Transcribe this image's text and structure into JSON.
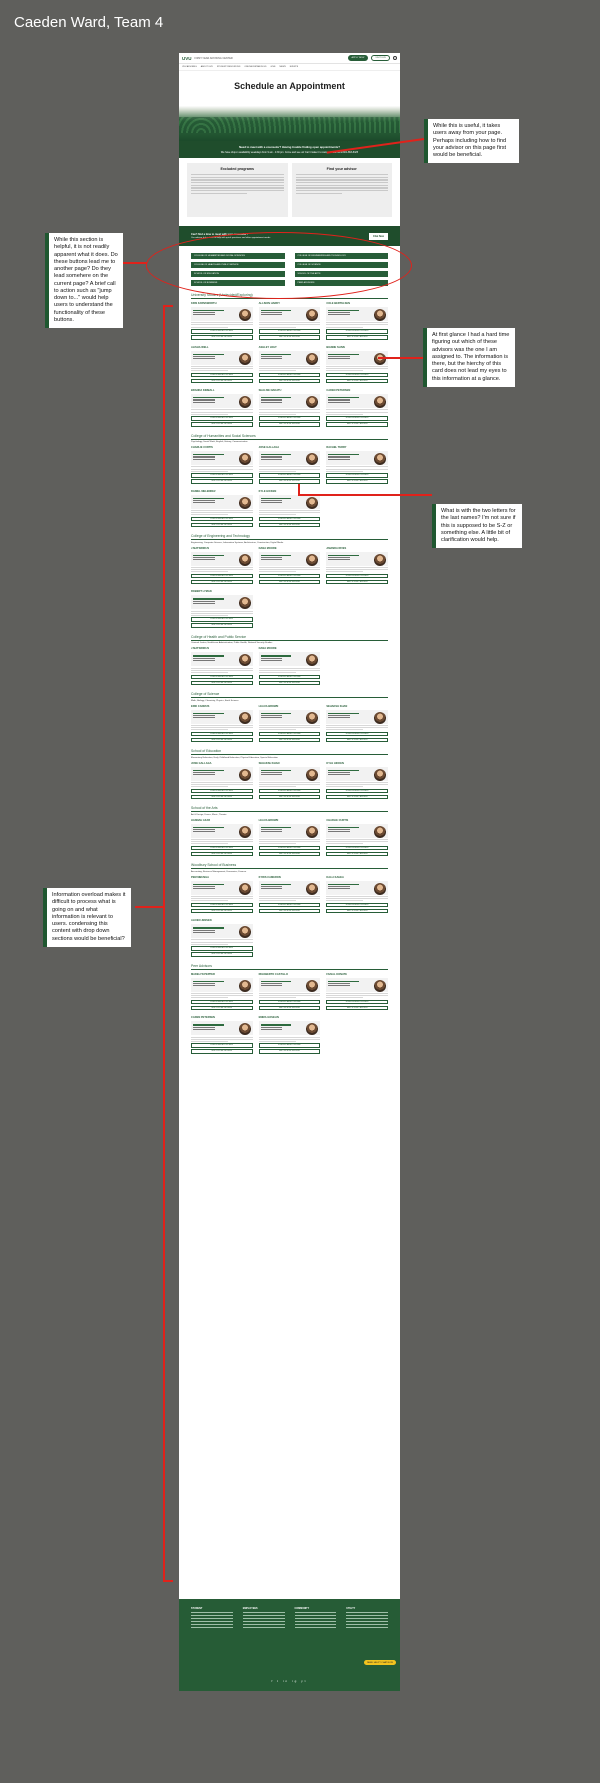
{
  "board": {
    "title": "Caeden Ward, Team 4"
  },
  "site": {
    "logo": "UVU",
    "top_text": "FIRST-YEAR ADVISING CENTER",
    "pill_primary": "APPLY NOW",
    "pill_secondary": "VISIT UVU",
    "nav": [
      "UVU ADVISING",
      "ABOUT UVU",
      "STUDENT RESOURCES",
      "ONLINE/DISTANCE ED",
      "GIVE",
      "NEWS",
      "EVENTS"
    ],
    "page_title": "Schedule an Appointment",
    "banner_line1": "Need to meet with a counselor? Having trouble finding open appointments?",
    "banner_line2": "We have drop-in availability weekdays from 9 am - 4:30 pm. Come and see us! Can't make it to campus? Call us at 801-863-8425",
    "excluded_title": "Excluded programs",
    "advisor_title": "Find your advisor",
    "cta_line1": "Can't find a time to meet with your counselor?",
    "cta_line2": "Our advisor hub is here to help with quick questions and other appointment needs.",
    "cta_button": "Chat Now",
    "jump_links": [
      "COLLEGE OF HUMANITIES AND SOCIAL SCIENCES",
      "COLLEGE OF ENGINEERING AND TECHNOLOGY",
      "COLLEGE OF HEALTH AND PUBLIC SERVICE",
      "COLLEGE OF SCIENCE",
      "SCHOOL OF EDUCATION",
      "SCHOOL OF THE ARTS",
      "SCHOOL OF BUSINESS",
      "PEER ADVISORS"
    ],
    "footer_cols": [
      "STUDENT",
      "EMPLOYEES",
      "COMMUNITY",
      "UTILITY"
    ],
    "help_pill": "NEED HELP? CHAT NOW",
    "social": "f t in ig yt"
  },
  "sections": [
    {
      "title": "University Studies (Undecided/Exploring)",
      "majors": "",
      "advisors": [
        "KRIS FARNSWORTH",
        "ALLISON HARDY",
        "COLE BERTELSEN",
        "ALISHA WELL",
        "ASHLEY HOLT",
        "BIANNE SLINN",
        "BRANDA KIMBALL",
        "SHALISE NAKATU",
        "CADEN PETERSEN"
      ]
    },
    {
      "title": "College of Humanities and Social Sciences",
      "majors": "Psychology, Social Work, English, History, Communication",
      "advisors": [
        "CHARLIE CURTIS",
        "JOSE GALLAGA",
        "RACHEL TERRY",
        "DANIEL MELENDEZ",
        "KYLE HICKEN"
      ]
    },
    {
      "title": "College of Engineering and Technology",
      "majors": "Engineering, Computer Science, Information Systems, Architecture, Construction, Digital Media",
      "advisors": [
        "J MATSIRIKUS",
        "DANA MOORE",
        "AMANDA RIVES",
        "ROBERT LYMAN"
      ]
    },
    {
      "title": "College of Health and Public Service",
      "majors": "Criminal Justice, Healthcare Administration, Public Health, National Security Studies",
      "advisors": [
        "J MATSIRIKUS",
        "DANA MOORE"
      ]
    },
    {
      "title": "College of Science",
      "majors": "Math, Biology, Chemistry, Physics, Earth Science",
      "advisors": [
        "ERIK CADMUS",
        "LEAUA BROWN",
        "SEHAKSH KHAN"
      ]
    },
    {
      "title": "School of Education",
      "majors": "Elementary Education, Early Childhood Education, Physical Education, Special Education",
      "advisors": [
        "JOSE GALLAGA",
        "SEHAKSH KHAN",
        "KYLE HICKEN"
      ]
    },
    {
      "title": "School of the Arts",
      "majors": "Art & Design, Dance, Music, Theater",
      "advisors": [
        "HANNAH AZAR",
        "LEAUA BROWN",
        "CHARLIE CURTIS"
      ]
    },
    {
      "title": "Woodbury School of Business",
      "majors": "Accounting, Business Management, Economics, Finance",
      "advisors": [
        "PEM MBUNGA",
        "KYRIS CAMERON",
        "KALLI KAHEA",
        "ALIXEN JENSEN"
      ]
    },
    {
      "title": "Peer Advisors",
      "majors": "",
      "advisors": [
        "MADELYN PEPPER",
        "RIGOBERTO CASTILLO",
        "FAISAL KONATE",
        "CADEN PETERSEN",
        "EMMA GOSELIN"
      ]
    }
  ],
  "notes": {
    "n1": "While this is useful, it takes users away from your page. Perhaps including how to find your advisor on this page first would be beneficial.",
    "n2": "While this section is helpful, it is not readily apparent what it does. Do these buttons lead me to another page? Do they lead somehere on the current page? A brief call to action such as \"jump down to...\" would help users to understand the functionality of these buttons.",
    "n3": "At first glance I had a hard time figuring out which of these advisors was the one I am assigned to. The information is there, but the hierchy of this card does not lead my eyes to this information at a glance.",
    "n4": "What is with the two letters for the last names? I'm not sure if this is supposed to be S-Z or something else. A little bit of clarification would help.",
    "n5": "Information overload makes it difficult to process what is going on and what information is relevant to users. condensing this content with drop down sections would be beneficial?"
  },
  "card_labels": {
    "button1": "SCHEDULE AN APPOINTMENT",
    "button2": "MEET WITH ME - ADVISING"
  },
  "colors": {
    "board": "#5f5f5c",
    "brand_green": "#275d38",
    "annotation_red": "#e0221b"
  }
}
